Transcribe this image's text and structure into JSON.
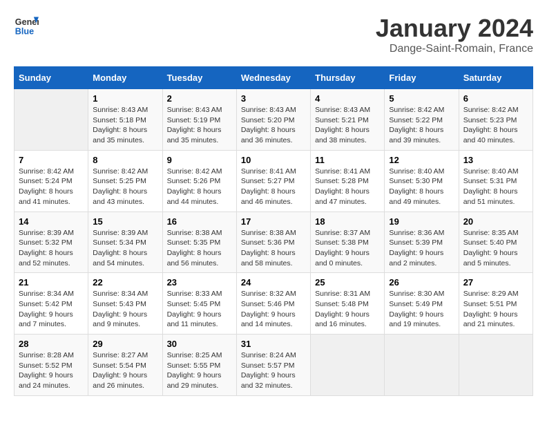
{
  "header": {
    "logo_line1": "General",
    "logo_line2": "Blue",
    "month": "January 2024",
    "location": "Dange-Saint-Romain, France"
  },
  "weekdays": [
    "Sunday",
    "Monday",
    "Tuesday",
    "Wednesday",
    "Thursday",
    "Friday",
    "Saturday"
  ],
  "weeks": [
    [
      {
        "day": "",
        "sunrise": "",
        "sunset": "",
        "daylight": ""
      },
      {
        "day": "1",
        "sunrise": "Sunrise: 8:43 AM",
        "sunset": "Sunset: 5:18 PM",
        "daylight": "Daylight: 8 hours and 35 minutes."
      },
      {
        "day": "2",
        "sunrise": "Sunrise: 8:43 AM",
        "sunset": "Sunset: 5:19 PM",
        "daylight": "Daylight: 8 hours and 35 minutes."
      },
      {
        "day": "3",
        "sunrise": "Sunrise: 8:43 AM",
        "sunset": "Sunset: 5:20 PM",
        "daylight": "Daylight: 8 hours and 36 minutes."
      },
      {
        "day": "4",
        "sunrise": "Sunrise: 8:43 AM",
        "sunset": "Sunset: 5:21 PM",
        "daylight": "Daylight: 8 hours and 38 minutes."
      },
      {
        "day": "5",
        "sunrise": "Sunrise: 8:42 AM",
        "sunset": "Sunset: 5:22 PM",
        "daylight": "Daylight: 8 hours and 39 minutes."
      },
      {
        "day": "6",
        "sunrise": "Sunrise: 8:42 AM",
        "sunset": "Sunset: 5:23 PM",
        "daylight": "Daylight: 8 hours and 40 minutes."
      }
    ],
    [
      {
        "day": "7",
        "sunrise": "Sunrise: 8:42 AM",
        "sunset": "Sunset: 5:24 PM",
        "daylight": "Daylight: 8 hours and 41 minutes."
      },
      {
        "day": "8",
        "sunrise": "Sunrise: 8:42 AM",
        "sunset": "Sunset: 5:25 PM",
        "daylight": "Daylight: 8 hours and 43 minutes."
      },
      {
        "day": "9",
        "sunrise": "Sunrise: 8:42 AM",
        "sunset": "Sunset: 5:26 PM",
        "daylight": "Daylight: 8 hours and 44 minutes."
      },
      {
        "day": "10",
        "sunrise": "Sunrise: 8:41 AM",
        "sunset": "Sunset: 5:27 PM",
        "daylight": "Daylight: 8 hours and 46 minutes."
      },
      {
        "day": "11",
        "sunrise": "Sunrise: 8:41 AM",
        "sunset": "Sunset: 5:28 PM",
        "daylight": "Daylight: 8 hours and 47 minutes."
      },
      {
        "day": "12",
        "sunrise": "Sunrise: 8:40 AM",
        "sunset": "Sunset: 5:30 PM",
        "daylight": "Daylight: 8 hours and 49 minutes."
      },
      {
        "day": "13",
        "sunrise": "Sunrise: 8:40 AM",
        "sunset": "Sunset: 5:31 PM",
        "daylight": "Daylight: 8 hours and 51 minutes."
      }
    ],
    [
      {
        "day": "14",
        "sunrise": "Sunrise: 8:39 AM",
        "sunset": "Sunset: 5:32 PM",
        "daylight": "Daylight: 8 hours and 52 minutes."
      },
      {
        "day": "15",
        "sunrise": "Sunrise: 8:39 AM",
        "sunset": "Sunset: 5:34 PM",
        "daylight": "Daylight: 8 hours and 54 minutes."
      },
      {
        "day": "16",
        "sunrise": "Sunrise: 8:38 AM",
        "sunset": "Sunset: 5:35 PM",
        "daylight": "Daylight: 8 hours and 56 minutes."
      },
      {
        "day": "17",
        "sunrise": "Sunrise: 8:38 AM",
        "sunset": "Sunset: 5:36 PM",
        "daylight": "Daylight: 8 hours and 58 minutes."
      },
      {
        "day": "18",
        "sunrise": "Sunrise: 8:37 AM",
        "sunset": "Sunset: 5:38 PM",
        "daylight": "Daylight: 9 hours and 0 minutes."
      },
      {
        "day": "19",
        "sunrise": "Sunrise: 8:36 AM",
        "sunset": "Sunset: 5:39 PM",
        "daylight": "Daylight: 9 hours and 2 minutes."
      },
      {
        "day": "20",
        "sunrise": "Sunrise: 8:35 AM",
        "sunset": "Sunset: 5:40 PM",
        "daylight": "Daylight: 9 hours and 5 minutes."
      }
    ],
    [
      {
        "day": "21",
        "sunrise": "Sunrise: 8:34 AM",
        "sunset": "Sunset: 5:42 PM",
        "daylight": "Daylight: 9 hours and 7 minutes."
      },
      {
        "day": "22",
        "sunrise": "Sunrise: 8:34 AM",
        "sunset": "Sunset: 5:43 PM",
        "daylight": "Daylight: 9 hours and 9 minutes."
      },
      {
        "day": "23",
        "sunrise": "Sunrise: 8:33 AM",
        "sunset": "Sunset: 5:45 PM",
        "daylight": "Daylight: 9 hours and 11 minutes."
      },
      {
        "day": "24",
        "sunrise": "Sunrise: 8:32 AM",
        "sunset": "Sunset: 5:46 PM",
        "daylight": "Daylight: 9 hours and 14 minutes."
      },
      {
        "day": "25",
        "sunrise": "Sunrise: 8:31 AM",
        "sunset": "Sunset: 5:48 PM",
        "daylight": "Daylight: 9 hours and 16 minutes."
      },
      {
        "day": "26",
        "sunrise": "Sunrise: 8:30 AM",
        "sunset": "Sunset: 5:49 PM",
        "daylight": "Daylight: 9 hours and 19 minutes."
      },
      {
        "day": "27",
        "sunrise": "Sunrise: 8:29 AM",
        "sunset": "Sunset: 5:51 PM",
        "daylight": "Daylight: 9 hours and 21 minutes."
      }
    ],
    [
      {
        "day": "28",
        "sunrise": "Sunrise: 8:28 AM",
        "sunset": "Sunset: 5:52 PM",
        "daylight": "Daylight: 9 hours and 24 minutes."
      },
      {
        "day": "29",
        "sunrise": "Sunrise: 8:27 AM",
        "sunset": "Sunset: 5:54 PM",
        "daylight": "Daylight: 9 hours and 26 minutes."
      },
      {
        "day": "30",
        "sunrise": "Sunrise: 8:25 AM",
        "sunset": "Sunset: 5:55 PM",
        "daylight": "Daylight: 9 hours and 29 minutes."
      },
      {
        "day": "31",
        "sunrise": "Sunrise: 8:24 AM",
        "sunset": "Sunset: 5:57 PM",
        "daylight": "Daylight: 9 hours and 32 minutes."
      },
      {
        "day": "",
        "sunrise": "",
        "sunset": "",
        "daylight": ""
      },
      {
        "day": "",
        "sunrise": "",
        "sunset": "",
        "daylight": ""
      },
      {
        "day": "",
        "sunrise": "",
        "sunset": "",
        "daylight": ""
      }
    ]
  ]
}
